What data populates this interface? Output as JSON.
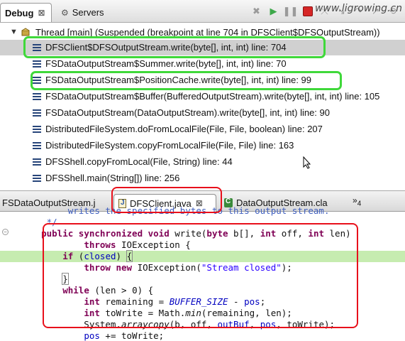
{
  "debug_view": {
    "tabs": [
      {
        "label": "Debug",
        "close": "⊠",
        "icon": "debug-bug-icon"
      },
      {
        "label": "Servers",
        "icon": "servers-icon"
      }
    ],
    "toolbar": [
      {
        "icon": "remove-terminated-icon",
        "glyph": "✖"
      },
      {
        "icon": "resume-icon",
        "glyph": "▶"
      },
      {
        "icon": "suspend-icon",
        "glyph": "❚❚"
      },
      {
        "icon": "terminate-icon",
        "glyph": ""
      },
      {
        "icon": "disconnect-icon",
        "glyph": "⤫"
      },
      {
        "icon": "step-into-icon",
        "glyph": "↘"
      },
      {
        "icon": "step-over-icon",
        "glyph": "↷"
      },
      {
        "icon": "step-return-icon",
        "glyph": "↗"
      },
      {
        "icon": "drop-to-frame-icon",
        "glyph": "⟲"
      }
    ],
    "watermark": "www.ligrowing.cn",
    "thread": {
      "label": "Thread [main] (Suspended (breakpoint at line 704 in DFSClient$DFSOutputStream))",
      "expanded": true
    },
    "frames": [
      {
        "label": "DFSClient$DFSOutputStream.write(byte[], int, int) line: 704",
        "selected": true,
        "highlight": "green"
      },
      {
        "label": "FSDataOutputStream$Summer.write(byte[], int, int) line: 70",
        "selected": false
      },
      {
        "label": "FSDataOutputStream$PositionCache.write(byte[], int, int) line: 99",
        "selected": false,
        "highlight": "green"
      },
      {
        "label": "FSDataOutputStream$Buffer(BufferedOutputStream).write(byte[], int, int) line: 105",
        "selected": false
      },
      {
        "label": "FSDataOutputStream(DataOutputStream).write(byte[], int, int) line: 90",
        "selected": false
      },
      {
        "label": "DistributedFileSystem.doFromLocalFile(File, File, boolean) line: 207",
        "selected": false
      },
      {
        "label": "DistributedFileSystem.copyFromLocalFile(File, File) line: 163",
        "selected": false
      },
      {
        "label": "DFSShell.copyFromLocal(File, String) line: 44",
        "selected": false
      },
      {
        "label": "DFSShell.main(String[]) line: 256",
        "selected": false
      }
    ]
  },
  "editor": {
    "tabs": [
      {
        "label": "FSDataOutputStream.j",
        "active": false,
        "icon": "java-file-icon"
      },
      {
        "label": "DFSClient.java",
        "active": true,
        "close": "⊠",
        "icon": "java-file-icon"
      },
      {
        "label": "DataOutputStream.cla",
        "active": false,
        "icon": "class-file-icon"
      }
    ],
    "overflow": {
      "glyph": "»",
      "count": "4"
    },
    "current_line_index": 4,
    "lines": [
      [
        {
          "t": "         writes the specified bytes to this output stream.",
          "c": "cm"
        }
      ],
      [
        {
          "t": "     */",
          "c": "cm"
        }
      ],
      [
        {
          "t": "    "
        },
        {
          "t": "public synchronized void",
          "c": "kw"
        },
        {
          "t": " write(",
          "c": ""
        },
        {
          "t": "byte",
          "c": "kw"
        },
        {
          "t": " b[], "
        },
        {
          "t": "int",
          "c": "kw"
        },
        {
          "t": " off, "
        },
        {
          "t": "int",
          "c": "kw"
        },
        {
          "t": " len)"
        }
      ],
      [
        {
          "t": "            "
        },
        {
          "t": "throws",
          "c": "kw"
        },
        {
          "t": " IOException {"
        }
      ],
      [
        {
          "t": "        "
        },
        {
          "t": "if",
          "c": "kw"
        },
        {
          "t": " ("
        },
        {
          "t": "closed",
          "c": "fld"
        },
        {
          "t": ") "
        },
        {
          "t": "{",
          "c": "bracket"
        }
      ],
      [
        {
          "t": "            "
        },
        {
          "t": "throw new",
          "c": "kw"
        },
        {
          "t": " IOException("
        },
        {
          "t": "\"Stream closed\"",
          "c": "str"
        },
        {
          "t": ");"
        }
      ],
      [
        {
          "t": "        "
        },
        {
          "t": "}",
          "c": "bracket"
        }
      ],
      [
        {
          "t": "        "
        },
        {
          "t": "while",
          "c": "kw"
        },
        {
          "t": " (len > 0) {"
        }
      ],
      [
        {
          "t": "            "
        },
        {
          "t": "int",
          "c": "kw"
        },
        {
          "t": " remaining = "
        },
        {
          "t": "BUFFER_SIZE",
          "c": "st"
        },
        {
          "t": " - "
        },
        {
          "t": "pos",
          "c": "fld"
        },
        {
          "t": ";"
        }
      ],
      [
        {
          "t": "            "
        },
        {
          "t": "int",
          "c": "kw"
        },
        {
          "t": " toWrite = Math."
        },
        {
          "t": "min",
          "c": "it"
        },
        {
          "t": "(remaining, len);"
        }
      ],
      [
        {
          "t": "            System."
        },
        {
          "t": "arraycopy",
          "c": "it"
        },
        {
          "t": "(b, off, "
        },
        {
          "t": "outBuf",
          "c": "fld"
        },
        {
          "t": ", "
        },
        {
          "t": "pos",
          "c": "fld"
        },
        {
          "t": ", toWrite);"
        }
      ],
      [
        {
          "t": "            "
        },
        {
          "t": "pos",
          "c": "fld"
        },
        {
          "t": " += toWrite;"
        }
      ]
    ]
  }
}
